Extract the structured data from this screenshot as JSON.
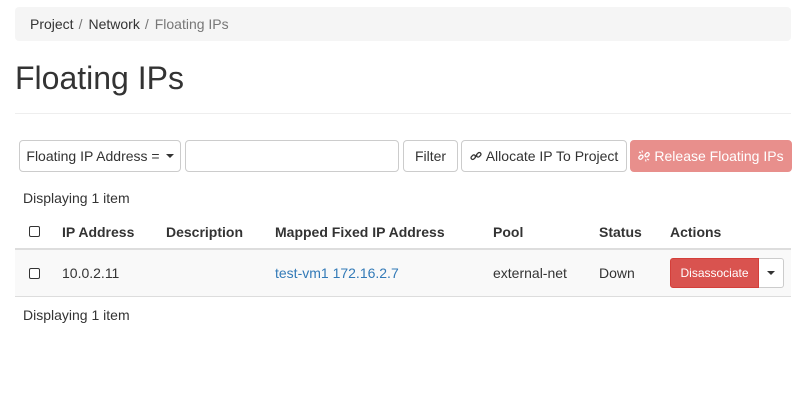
{
  "breadcrumb": {
    "items": [
      "Project",
      "Network"
    ],
    "separator": "/",
    "active": "Floating IPs"
  },
  "page": {
    "title": "Floating IPs"
  },
  "toolbar": {
    "filter_field_label": "Floating IP Address =",
    "filter_input_value": "",
    "filter_button": "Filter",
    "allocate_button": "Allocate IP To Project",
    "release_button": "Release Floating IPs",
    "release_color": "#e88f8c"
  },
  "table": {
    "display_count_top": "Displaying 1 item",
    "display_count_bottom": "Displaying 1 item",
    "columns": [
      "IP Address",
      "Description",
      "Mapped Fixed IP Address",
      "Pool",
      "Status",
      "Actions"
    ],
    "rows": [
      {
        "ip_address": "10.0.2.11",
        "description": "",
        "mapped_fixed_ip": "test-vm1 172.16.2.7",
        "pool": "external-net",
        "status": "Down",
        "action": "Disassociate"
      }
    ]
  },
  "colors": {
    "danger": "#d9534f",
    "link": "#337ab7"
  }
}
